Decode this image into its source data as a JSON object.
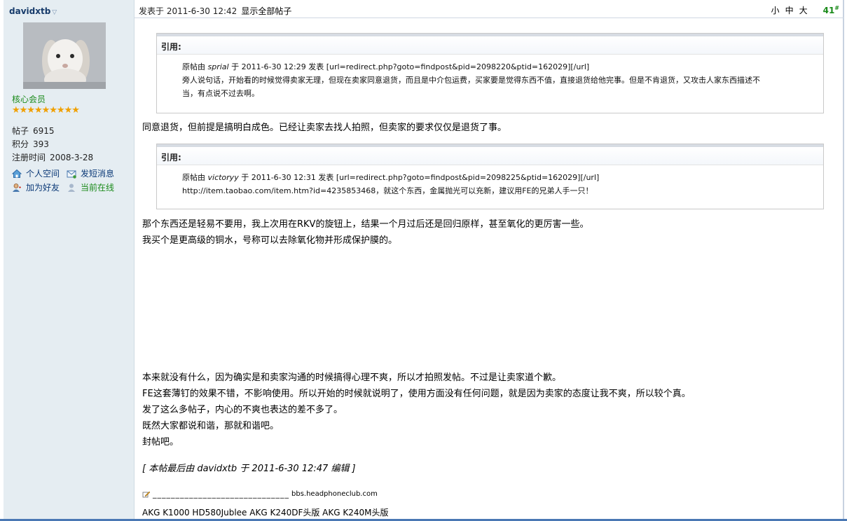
{
  "author": {
    "username": "davidxtb",
    "group": "核心会员",
    "stars": "★★★★★★★★★",
    "stats": [
      {
        "label": "帖子",
        "value": "6915"
      },
      {
        "label": "积分",
        "value": "393"
      },
      {
        "label": "注册时间",
        "value": "2008-3-28"
      }
    ],
    "actions": {
      "space": "个人空间",
      "message": "发短消息",
      "friend": "加为好友",
      "online": "当前在线"
    }
  },
  "post": {
    "posted_at": "发表于 2011-6-30 12:42",
    "show_all": "显示全部帖子",
    "font_small": "小",
    "font_medium": "中",
    "font_large": "大",
    "floor": "41",
    "floor_mark": "#"
  },
  "quotes": [
    {
      "label": "引用:",
      "prefix": "原帖由 ",
      "author": "sprial",
      "info": " 于 2011-6-30 12:29 发表 [url=redirect.php?goto=findpost&pid=2098220&ptid=162029][/url]",
      "lines": [
        "旁人说句话，开始看的时候觉得卖家无理，但现在卖家同意退货，而且是中介包运费，买家要是觉得东西不值，直接退货给他完事。但是不肯退货，又攻击人家东西描述不",
        "当，有点说不过去啊。"
      ]
    },
    {
      "label": "引用:",
      "prefix": "原帖由 ",
      "author": "victoryy",
      "info": " 于 2011-6-30 12:31 发表 [url=redirect.php?goto=findpost&pid=2098225&ptid=162029][/url]",
      "lines": [
        "http://item.taobao.com/item.htm?id=4235853468，就这个东西，金属抛光可以充新，建议用FE的兄弟人手一只！"
      ]
    }
  ],
  "body": {
    "reply1": "同意退货，但前提是搞明白成色。已经让卖家去找人拍照，但卖家的要求仅仅是退货了事。",
    "reply2": [
      "那个东西还是轻易不要用，我上次用在RKV的旋钮上，结果一个月过后还是回归原样，甚至氧化的更厉害一些。",
      "我买个是更高级的铜水，号称可以去除氧化物并形成保护膜的。"
    ],
    "reply3": [
      "本来就没有什么，因为确实是和卖家沟通的时候搞得心理不爽，所以才拍照发帖。不过是让卖家道个歉。",
      "FE这套薄钉的效果不错，不影响使用。所以开始的时候就说明了，使用方面没有任何问题，就是因为卖家的态度让我不爽，所以较个真。",
      "发了这么多帖子，内心的不爽也表达的差不多了。",
      "既然大家都说和谐，那就和谐吧。",
      "封帖吧。"
    ],
    "edit_note": "[ 本帖最后由 davidxtb 于 2011-6-30 12:47 编辑 ]"
  },
  "signature": {
    "dashes": "______________________________",
    "site": "bbs.headphoneclub.com",
    "gear": "AKG K1000 HD580Jublee AKG K240DF头版 AKG K240M头版"
  }
}
